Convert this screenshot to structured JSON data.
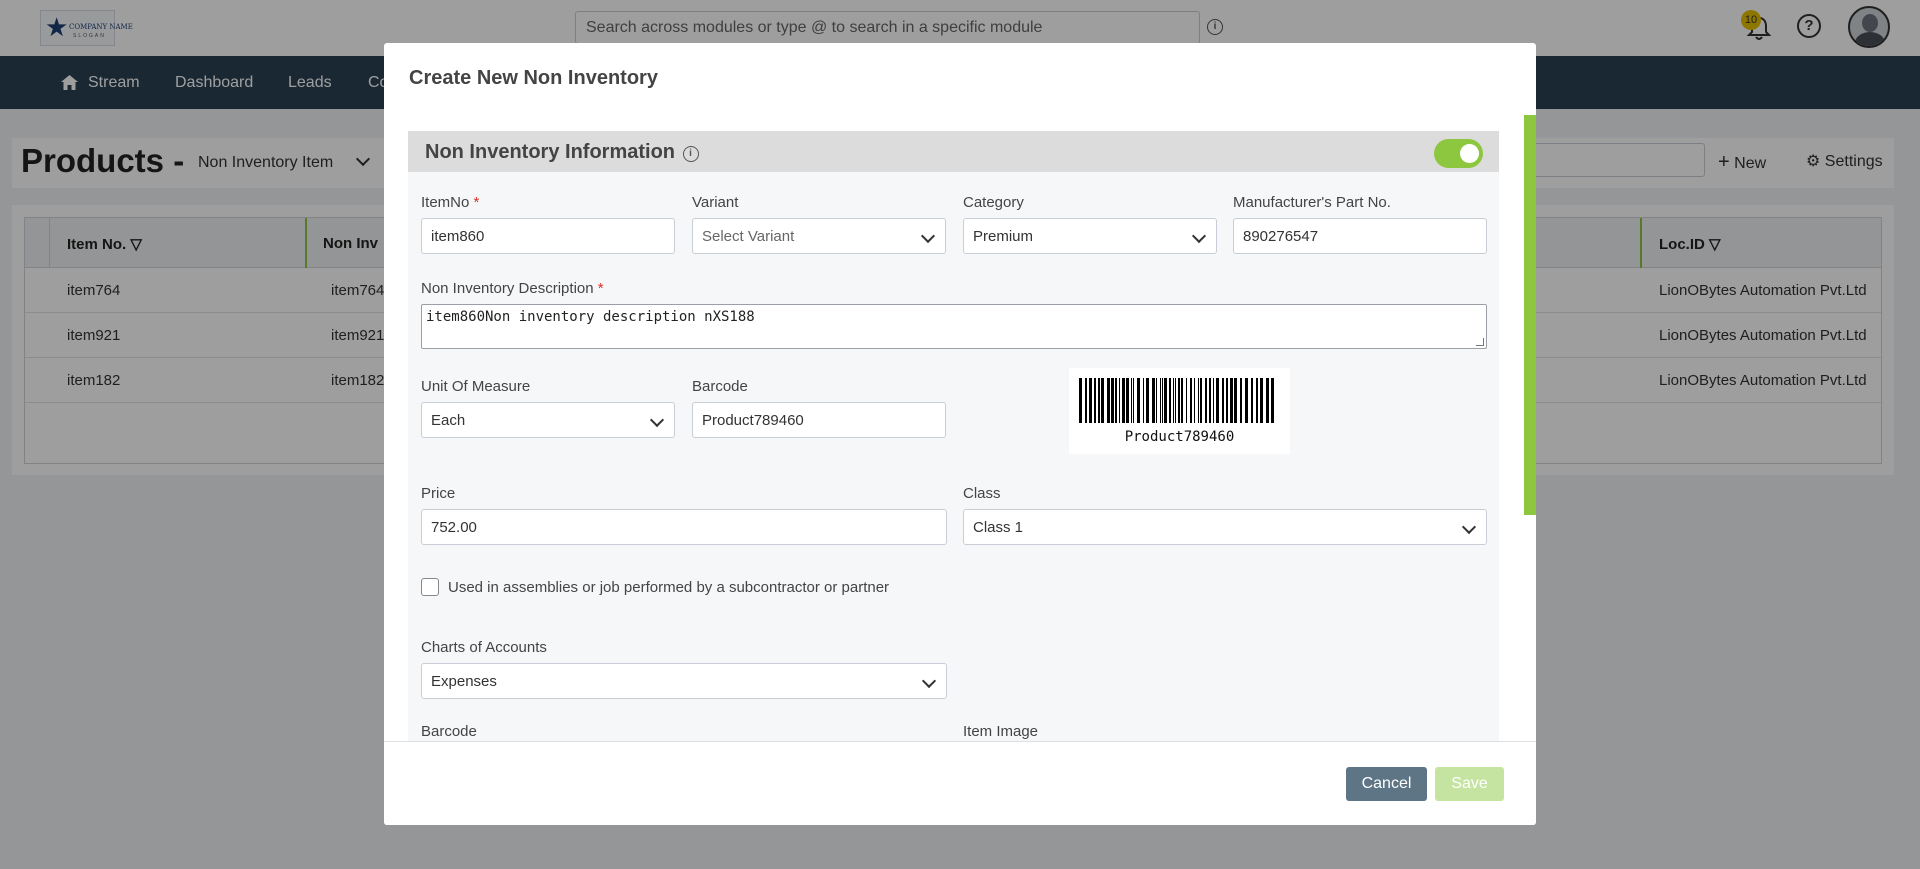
{
  "colors": {
    "nav_bg": "#2a4155",
    "accent_green": "#8dc63f",
    "cancel_bg": "#5e7585",
    "save_bg_disabled": "#c5e3a1"
  },
  "topbar": {
    "logo_text": "COMPANY NAME",
    "logo_tagline": "SLOGAN",
    "search_placeholder": "Search across modules or type @ to search in a specific module",
    "notification_count": "10"
  },
  "nav": {
    "items": [
      "Stream",
      "Dashboard",
      "Leads",
      "Co"
    ]
  },
  "products": {
    "title": "Products -",
    "view": "Non Inventory Item",
    "search_placeholder": "",
    "new_label": "New",
    "settings_label": "Settings"
  },
  "grid": {
    "columns": [
      "Item No.",
      "Non Inv",
      "Loc.ID"
    ],
    "rows": [
      {
        "item_no": "item764",
        "non_inv": "item764",
        "loc": "LionOBytes Automation Pvt.Ltd"
      },
      {
        "item_no": "item921",
        "non_inv": "item921",
        "loc": "LionOBytes Automation Pvt.Ltd"
      },
      {
        "item_no": "item182",
        "non_inv": "item182",
        "loc": "LionOBytes Automation Pvt.Ltd"
      }
    ]
  },
  "modal": {
    "title": "Create New Non Inventory",
    "section_title": "Non Inventory Information",
    "section_enabled": true,
    "fields": {
      "item_no_label": "ItemNo",
      "item_no_value": "item860",
      "variant_label": "Variant",
      "variant_placeholder": "Select Variant",
      "category_label": "Category",
      "category_value": "Premium",
      "mpn_label": "Manufacturer's Part No.",
      "mpn_value": "890276547",
      "description_label": "Non Inventory Description",
      "description_value": "item860Non inventory description nXS188",
      "uom_label": "Unit Of Measure",
      "uom_value": "Each",
      "barcode_label": "Barcode",
      "barcode_value": "Product789460",
      "barcode_image_text": "Product789460",
      "price_label": "Price",
      "price_value": "752.00",
      "class_label": "Class",
      "class_value": "Class 1",
      "assemblies_label": "Used in assemblies or job performed by a subcontractor or partner",
      "assemblies_checked": false,
      "coa_label": "Charts of Accounts",
      "coa_value": "Expenses",
      "barcode2_label": "Barcode",
      "item_image_label": "Item Image",
      "required_mark": "*"
    },
    "cancel_label": "Cancel",
    "save_label": "Save"
  }
}
